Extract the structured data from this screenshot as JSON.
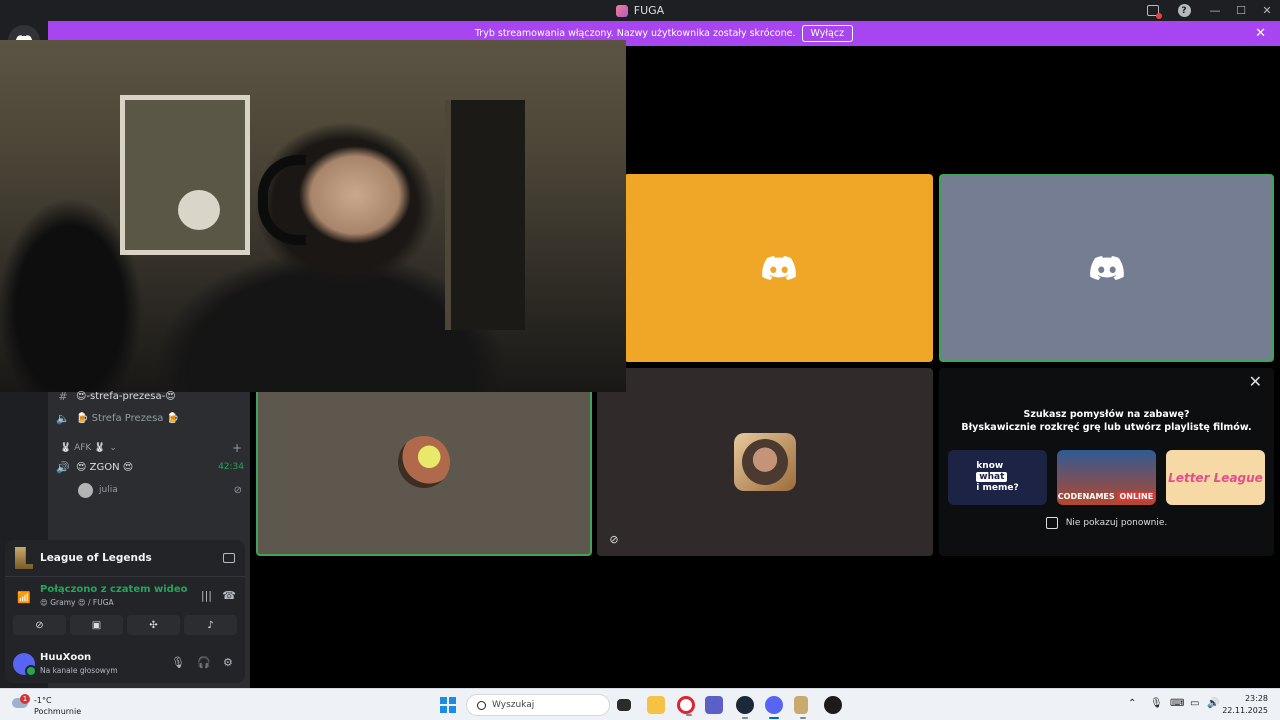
{
  "window": {
    "title": "FUGA"
  },
  "banner": {
    "text": "Tryb streamowania włączony. Nazwy użytkownika zostały skrócone.",
    "button": "Wyłącz"
  },
  "channels": [
    {
      "name": "😍-strefa-prezesa-😍",
      "icon": "hashtag-icon"
    },
    {
      "name": "🍺 Strefa Prezesa 🍺",
      "icon": "speaker-icon"
    }
  ],
  "category": {
    "name": "🐰 AFK 🐰"
  },
  "voice_channel": {
    "name": "😍 ZGON 😍",
    "timer": "42:34"
  },
  "member": {
    "name": "julia"
  },
  "voice_panel": {
    "game": "League of Legends",
    "status": "Połączono z czatem wideo",
    "channel_path": "😍 Gramy 😍 / FUGA",
    "user": "HuuXoon",
    "user_status": "Na kanale głosowym"
  },
  "suggestion": {
    "title": "Szukasz pomysłów na zabawę?",
    "subtitle": "Błyskawicznie rozkręć grę lub utwórz playlistę filmów.",
    "cards": [
      {
        "line1": "know",
        "line2": "what",
        "line3": "i meme?"
      },
      {
        "name": "CODENAMES",
        "suffix": "ONLINE"
      },
      {
        "name": "Letter League"
      }
    ],
    "dont_show": "Nie pokazuj ponownie."
  },
  "taskbar": {
    "weather_badge": "1",
    "temp": "-1°C",
    "weather_desc": "Pochmurnie",
    "search_placeholder": "Wyszukaj",
    "time": "23:28",
    "date": "22.11.2025"
  },
  "colors": {
    "banner": "#a745f0",
    "orange_tile": "#f0a627",
    "gray_tile": "#747d91",
    "speaking_border": "#43a25a",
    "connected_green": "#23a55a"
  }
}
